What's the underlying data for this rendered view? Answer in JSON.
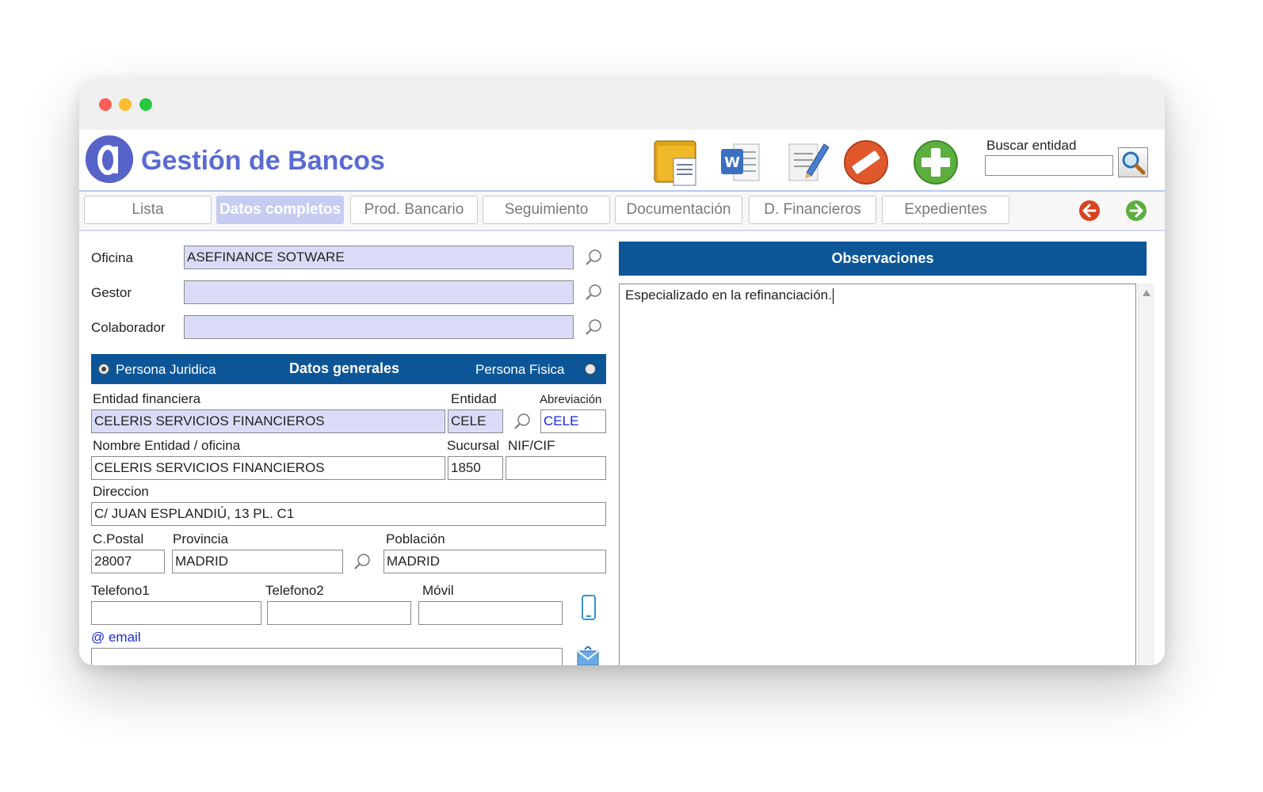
{
  "window": {
    "title": "Gestión de Bancos",
    "controls": [
      "close",
      "minimize",
      "maximize"
    ]
  },
  "toolbar": {
    "icons": [
      "documents-icon",
      "word-icon",
      "edit-note-icon",
      "delete-icon",
      "add-icon"
    ],
    "search_label": "Buscar entidad",
    "search_value": "",
    "search_button_icon": "search-icon"
  },
  "tabs": [
    {
      "label": "Lista",
      "active": false
    },
    {
      "label": "Datos completos",
      "active": true
    },
    {
      "label": "Prod. Bancario",
      "active": false
    },
    {
      "label": "Seguimiento",
      "active": false
    },
    {
      "label": "Documentación",
      "active": false
    },
    {
      "label": "D. Financieros",
      "active": false
    },
    {
      "label": "Expedientes",
      "active": false
    }
  ],
  "nav": {
    "prev_icon": "arrow-left-icon",
    "next_icon": "arrow-right-icon"
  },
  "top_fields": [
    {
      "label": "Oficina",
      "value": "ASEFINANCE SOTWARE"
    },
    {
      "label": "Gestor",
      "value": ""
    },
    {
      "label": "Colaborador",
      "value": ""
    }
  ],
  "general": {
    "title": "Datos generales",
    "radio_juridica": "Persona Juridica",
    "radio_fisica": "Persona Fisica",
    "selected": "Persona Juridica",
    "entidad_financiera_label": "Entidad financiera",
    "entidad_financiera": "CELERIS SERVICIOS FINANCIEROS",
    "entidad_label": "Entidad",
    "entidad": "CELE",
    "abreviacion_label": "Abreviación",
    "abreviacion": "CELE",
    "nombre_label": "Nombre Entidad / oficina",
    "nombre": "CELERIS SERVICIOS FINANCIEROS",
    "sucursal_label": "Sucursal",
    "sucursal": "1850",
    "nif_label": "NIF/CIF",
    "nif": "",
    "direccion_label": "Direccion",
    "direccion": "C/ JUAN ESPLANDIÚ, 13 PL. C1",
    "cpostal_label": "C.Postal",
    "cpostal": "28007",
    "provincia_label": "Provincia",
    "provincia": "MADRID",
    "poblacion_label": "Población",
    "poblacion": "MADRID",
    "telefono1_label": "Telefono1",
    "telefono1": "",
    "telefono2_label": "Telefono2",
    "telefono2": "",
    "movil_label": "Móvil",
    "movil": "",
    "email_label": "@ email",
    "email": ""
  },
  "observaciones": {
    "title": "Observaciones",
    "text": "Especializado en la refinanciación."
  },
  "colors": {
    "accent": "#5a6bd2",
    "header_bar": "#0c5698",
    "field_highlight": "#dadcf7",
    "tab_active": "#c6ccf2"
  }
}
